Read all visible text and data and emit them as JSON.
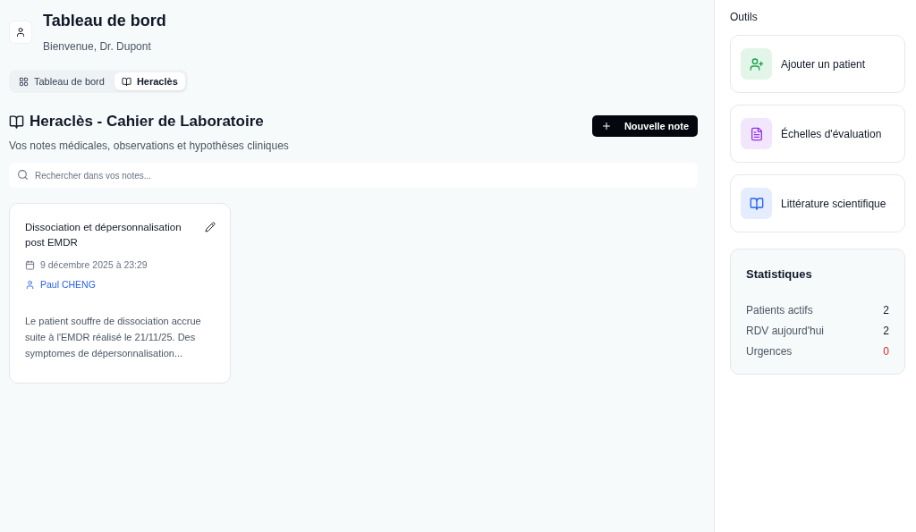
{
  "header": {
    "title": "Tableau de bord",
    "subtitle": "Bienvenue, Dr. Dupont"
  },
  "tabs": [
    {
      "label": "Tableau de bord",
      "kind": "grid",
      "selected": false
    },
    {
      "label": "Heraclès",
      "kind": "book",
      "selected": true
    }
  ],
  "notebook": {
    "title": "Heraclès - Cahier de Laboratoire",
    "subtitle": "Vos notes médicales, observations et hypothèses cliniques",
    "new_button": "Nouvelle note",
    "search": {
      "placeholder": "Rechercher dans vos notes..."
    }
  },
  "notes": [
    {
      "title": "Dissociation et dépersonnalisation post EMDR",
      "date": "9 décembre 2025 à 23:29",
      "patient": "Paul CHENG",
      "excerpt": "Le patient souffre de dissociation accrue suite à l'EMDR réalisé le 21/11/25. Des symptomes de dépersonnalisation..."
    }
  ],
  "sidebar": {
    "title": "Outils",
    "tools": [
      {
        "label": "Ajouter un patient",
        "kind": "add-user",
        "color": "#16a34a"
      },
      {
        "label": "Échelles d'évaluation",
        "kind": "document",
        "color": "#9333ea"
      },
      {
        "label": "Littérature scientifique",
        "kind": "book",
        "color": "#2563eb"
      }
    ],
    "stats": {
      "title": "Statistiques",
      "rows": [
        {
          "label": "Patients actifs",
          "value": "2",
          "alert": false
        },
        {
          "label": "RDV aujourd'hui",
          "value": "2",
          "alert": false
        },
        {
          "label": "Urgences",
          "value": "0",
          "alert": true
        }
      ]
    }
  }
}
